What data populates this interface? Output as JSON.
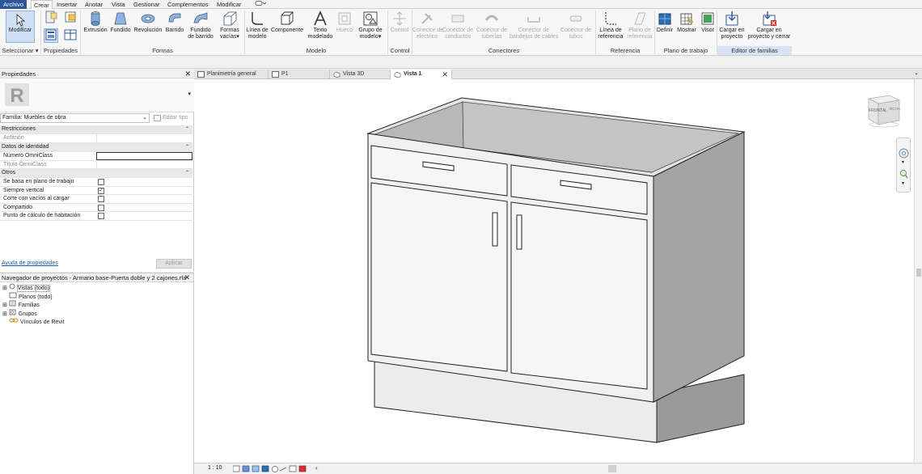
{
  "menubar": {
    "file": "Archivo",
    "tabs": [
      "Crear",
      "Insertar",
      "Anotar",
      "Vista",
      "Gestionar",
      "Complementos",
      "Modificar"
    ]
  },
  "ribbon": {
    "select": {
      "modify": "Modificar",
      "panel": "Seleccionar"
    },
    "properties_panel": "Propiedades",
    "forms": {
      "buttons": [
        "Extrusión",
        "Fundido",
        "Revolución",
        "Barrido"
      ],
      "sweep_blend": [
        "Fundido",
        "de barrido"
      ],
      "void": [
        "Formas",
        "vacías"
      ],
      "panel": "Formas"
    },
    "model": {
      "model_line": [
        "Línea de",
        "modelo"
      ],
      "component": "Componente",
      "model_text": [
        "Texto",
        "modelado"
      ],
      "opening": "Hueco",
      "model_group": [
        "Grupo de",
        "modelo"
      ],
      "panel": "Modelo"
    },
    "control": {
      "button": "Control",
      "panel": "Control"
    },
    "connectors": {
      "electrical": [
        "Conector de",
        "eléctrico"
      ],
      "duct": [
        "Conector de",
        "conductos"
      ],
      "pipe": [
        "Conector de",
        "tuberías"
      ],
      "cable_tray": [
        "Conector de",
        "bandejas de cables"
      ],
      "conduit": [
        "Conector de",
        "tubos"
      ],
      "panel": "Conectores"
    },
    "reference": {
      "ref_line": [
        "Línea de",
        "referencia"
      ],
      "ref_plane": [
        "Plano de",
        "referencia"
      ],
      "panel": "Referencia"
    },
    "workplane": {
      "set": "Definir",
      "show": "Mostrar",
      "viewer": "Visor",
      "panel": "Plano de trabajo"
    },
    "family_editor": {
      "load_project": [
        "Cargar en",
        "proyecto"
      ],
      "load_close": [
        "Cargar en",
        "proyecto y cerrar"
      ],
      "panel": "Editor de familias"
    }
  },
  "properties": {
    "title": "Propiedades",
    "family_selector": "Familia: Muebles de obra",
    "edit_type": "Editar tipo",
    "rows": [
      {
        "label": "Restricciones",
        "section": true
      },
      {
        "label": "Anfitrión",
        "greyed": true
      },
      {
        "label": "Datos de identidad",
        "section": true
      },
      {
        "label": "Número OmniClass"
      },
      {
        "label": "Título OmniClass",
        "greyed": true
      },
      {
        "label": "Otros",
        "section": true
      },
      {
        "label": "Se basa en plano de trabajo",
        "checked": false
      },
      {
        "label": "Siempre vertical",
        "checked": true
      },
      {
        "label": "Corte con vacíos al cargar",
        "checked": false
      },
      {
        "label": "Compartido",
        "checked": false
      },
      {
        "label": "Punto de cálculo de habitación",
        "checked": false
      }
    ],
    "help_link": "Ayuda de propiedades",
    "apply": "Aplicar"
  },
  "browser": {
    "title": "Navegador de proyectos - Armario base-Puerta doble y 2 cajones.rfa",
    "items": [
      "Vistas (todo)",
      "Planos (todo)",
      "Familias",
      "Grupos",
      "Vínculos de Revit"
    ]
  },
  "view_tabs": [
    "Planimetría general",
    "P1",
    "Vista 3D",
    "Vista 1"
  ],
  "viewcube": {
    "front": "FRONTAL",
    "right": "DCHA"
  },
  "status": {
    "scale": "1 : 10"
  },
  "colors": {
    "file_tab": "#2b579a",
    "accent_blue": "#d6e4f5"
  }
}
